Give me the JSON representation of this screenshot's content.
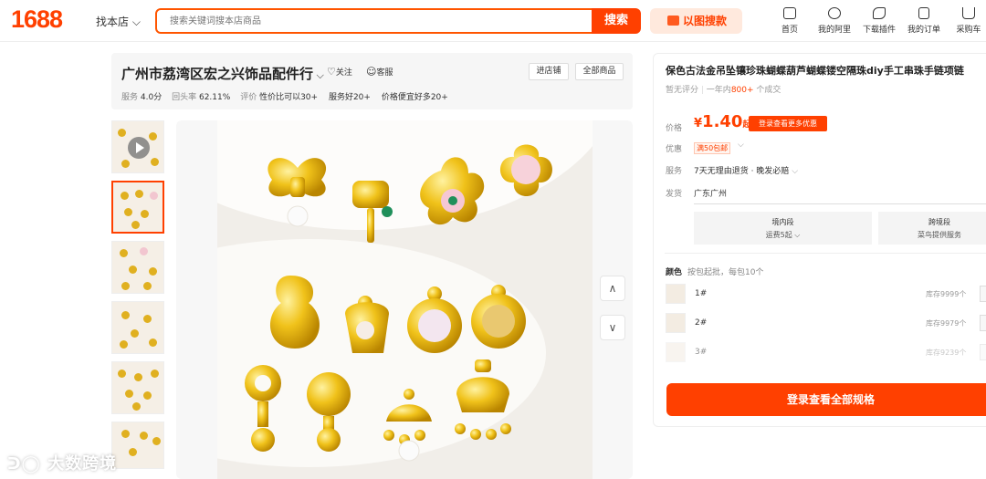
{
  "header": {
    "logo": "1688",
    "scope": "找本店",
    "search_placeholder": "搜索关键词搜本店商品",
    "search_button": "搜索",
    "image_search": "以图搜款",
    "nav": [
      {
        "label": "首页",
        "icon": "home-icon"
      },
      {
        "label": "我的阿里",
        "icon": "message-heart-icon"
      },
      {
        "label": "下载插件",
        "icon": "puzzle-icon"
      },
      {
        "label": "我的订单",
        "icon": "clipboard-icon"
      },
      {
        "label": "采购车",
        "icon": "cart-icon"
      }
    ]
  },
  "shop": {
    "name": "广州市荔湾区宏之兴饰品配件行",
    "follow": "关注",
    "service": "客服",
    "enter_shop": "进店铺",
    "all_products": "全部商品",
    "stats": {
      "service_label": "服务",
      "service_value": "4.0分",
      "repurchase_label": "回头率",
      "repurchase_value": "62.11%",
      "rating_label": "评价",
      "tags": [
        "性价比可以30+",
        "服务好20+",
        "价格便宜好多20+"
      ]
    }
  },
  "product": {
    "title": "保色古法金吊坠镶珍珠蝴蝶葫芦蝴蝶镂空隔珠diy手工串珠手链项链",
    "no_rating": "暂无评分",
    "sales_prefix": "一年内",
    "sales_count": "800+",
    "sales_suffix": "个成交",
    "price_label": "价格",
    "currency": "¥",
    "price": "1.40",
    "price_unit": "起",
    "login_discount": "登录查看更多优惠",
    "promo_label": "优惠",
    "promo_tag": "满50包邮",
    "service_label": "服务",
    "service_text": "7天无理由退货 · 晚发必赔",
    "ship_label": "发货",
    "ship_from": "广东广州",
    "shipping": [
      {
        "title": "境内段",
        "value": "运费5起"
      },
      {
        "title": "跨境段",
        "value": "菜鸟提供服务"
      }
    ],
    "color_label": "颜色",
    "color_hint": "按包起批，每包10个",
    "variants": [
      {
        "name": "1#",
        "stock": "库存9999个"
      },
      {
        "name": "2#",
        "stock": "库存9979个"
      },
      {
        "name": "3#",
        "stock": "库存9239个"
      }
    ],
    "cta": "登录查看全部规格"
  },
  "watermark": "大数跨境"
}
